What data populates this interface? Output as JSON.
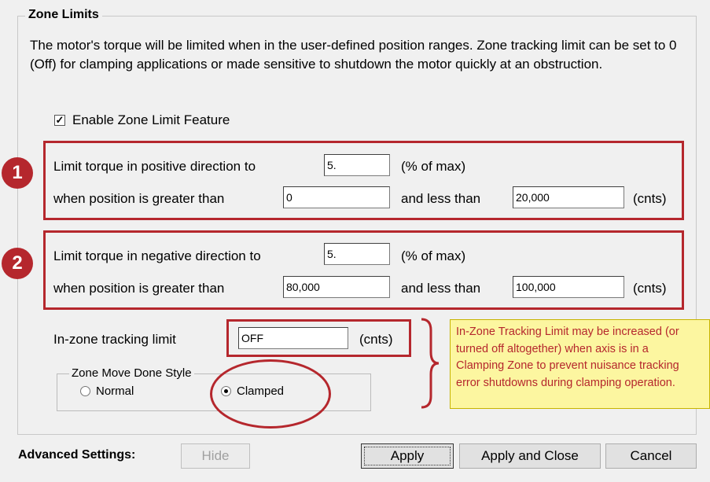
{
  "zone_limits": {
    "title": "Zone Limits",
    "description": "The motor's torque will be limited when in the user-defined position ranges. Zone tracking limit can be set to 0 (Off) for clamping applications or made sensitive to shutdown the motor quickly at an obstruction.",
    "enable_label": "Enable Zone Limit Feature",
    "enable_checked": true,
    "check_mark": "✓"
  },
  "zone1": {
    "badge": "1",
    "torque_label": "Limit torque in positive direction to",
    "torque_value": "5.",
    "torque_unit": "(% of max)",
    "position_label": "when position is greater than",
    "greater_value": "0",
    "less_label": "and less than",
    "less_value": "20,000",
    "cnts_unit": "(cnts)"
  },
  "zone2": {
    "badge": "2",
    "torque_label": "Limit torque in negative direction to",
    "torque_value": "5.",
    "torque_unit": "(% of max)",
    "position_label": "when position is greater than",
    "greater_value": "80,000",
    "less_label": "and less than",
    "less_value": "100,000",
    "cnts_unit": "(cnts)"
  },
  "tracking": {
    "label": "In-zone tracking limit",
    "value": "OFF",
    "unit": "(cnts)"
  },
  "move_done": {
    "title": "Zone Move Done Style",
    "options": [
      "Normal",
      "Clamped"
    ],
    "selected": "Clamped"
  },
  "note": {
    "lines": [
      "In-Zone Tracking Limit may be increased (or",
      "turned off altogether) when axis is in a",
      "Clamping Zone to prevent nuisance tracking",
      "error shutdowns during clamping operation."
    ]
  },
  "footer": {
    "advanced_label": "Advanced Settings:",
    "hide_button": "Hide",
    "apply_button": "Apply",
    "apply_close_button": "Apply and Close",
    "cancel_button": "Cancel"
  },
  "colors": {
    "annotation_red": "#b5272d",
    "note_background": "#fcf6a0",
    "dialog_background": "#f0f0f0"
  }
}
